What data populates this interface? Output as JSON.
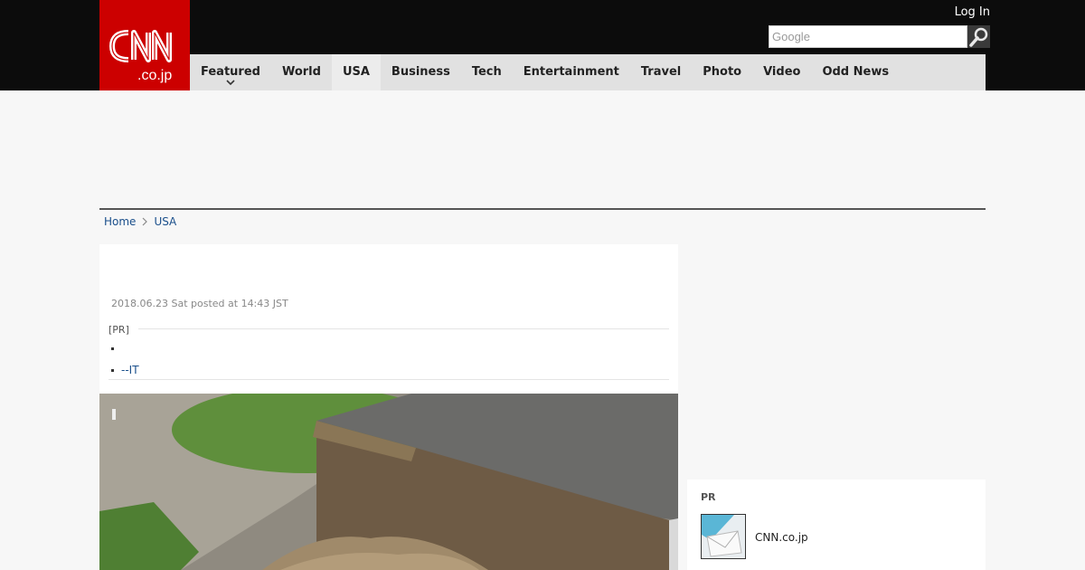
{
  "header": {
    "logo_text": "CNN.co.jp",
    "login_label": "Log In",
    "search": {
      "placeholder": "Google",
      "value": ""
    }
  },
  "nav": {
    "items": [
      {
        "label": "Featured"
      },
      {
        "label": "World"
      },
      {
        "label": "USA"
      },
      {
        "label": "Business"
      },
      {
        "label": "Tech"
      },
      {
        "label": "Entertainment"
      },
      {
        "label": "Travel"
      },
      {
        "label": "Photo"
      },
      {
        "label": "Video"
      },
      {
        "label": "Odd News"
      }
    ],
    "active": "USA"
  },
  "breadcrumb": {
    "items": [
      "Home",
      "USA"
    ]
  },
  "article": {
    "posted": "2018.06.23 Sat posted at 14:43 JST",
    "pr_label": "[PR]",
    "pr_links": [
      "",
      "--IT"
    ]
  },
  "sidebar": {
    "pr_label": "PR",
    "pr_item_label": "CNN.co.jp"
  },
  "colors": {
    "brand_red": "#cc0000",
    "topbar": "#0c0c0c",
    "nav_bg": "#e1e1e1",
    "link": "#1a4f8b"
  },
  "icons": {
    "search": "magnifier-icon",
    "nav_dropdown": "chevron-down-icon",
    "breadcrumb_sep": "chevron-right-icon"
  }
}
